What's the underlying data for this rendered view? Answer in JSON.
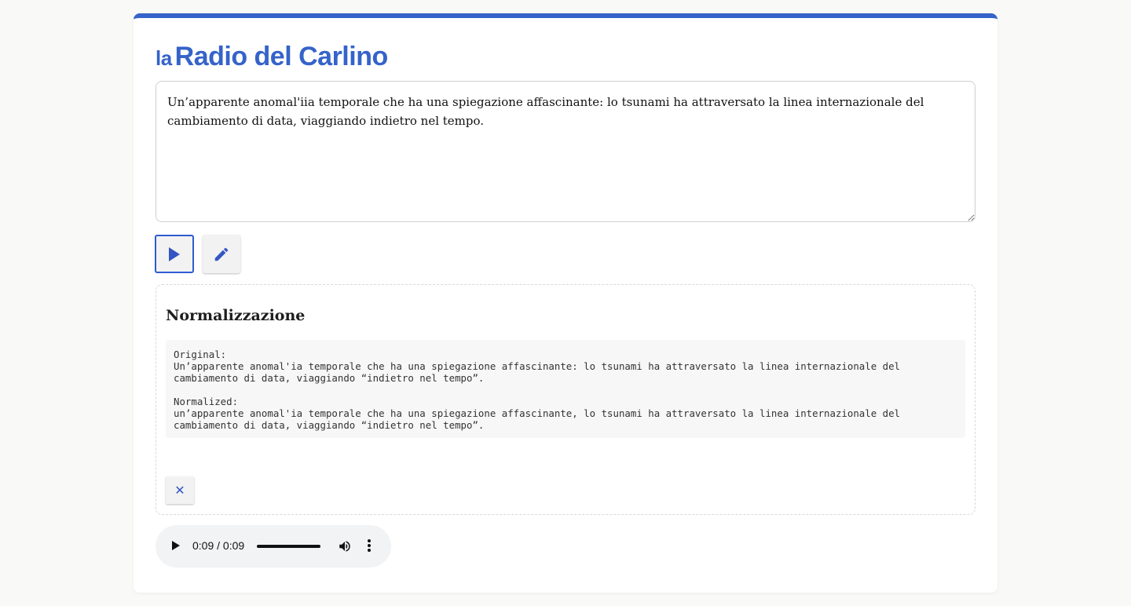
{
  "brand": {
    "prefix": "la",
    "name": "Radio del Carlino"
  },
  "editor": {
    "text": "Un’apparente anomal'iia temporale che ha una spiegazione affascinante: lo tsunami ha attraversato la linea internazionale del cambiamento di data, viaggiando indietro nel tempo."
  },
  "toolbar": {
    "play_icon": "play-icon",
    "edit_icon": "pencil-icon"
  },
  "normalization": {
    "title": "Normalizzazione",
    "original_label": "Original:",
    "original_text": "Un’apparente anomal'ia temporale che ha una spiegazione affascinante: lo tsunami ha attraversato la linea internazionale del cambiamento di data, viaggiando “indietro nel tempo”.",
    "normalized_label": "Normalized:",
    "normalized_text": "un’apparente anomal'ia temporale che ha una spiegazione affascinante, lo tsunami ha attraversato la linea internazionale del cambiamento di data, viaggiando “indietro nel tempo”.",
    "close_label": "✕"
  },
  "audio": {
    "time": "0:09 / 0:09",
    "progress": 1.0
  },
  "colors": {
    "accent": "#3563c9",
    "background": "#f9f9f8"
  }
}
